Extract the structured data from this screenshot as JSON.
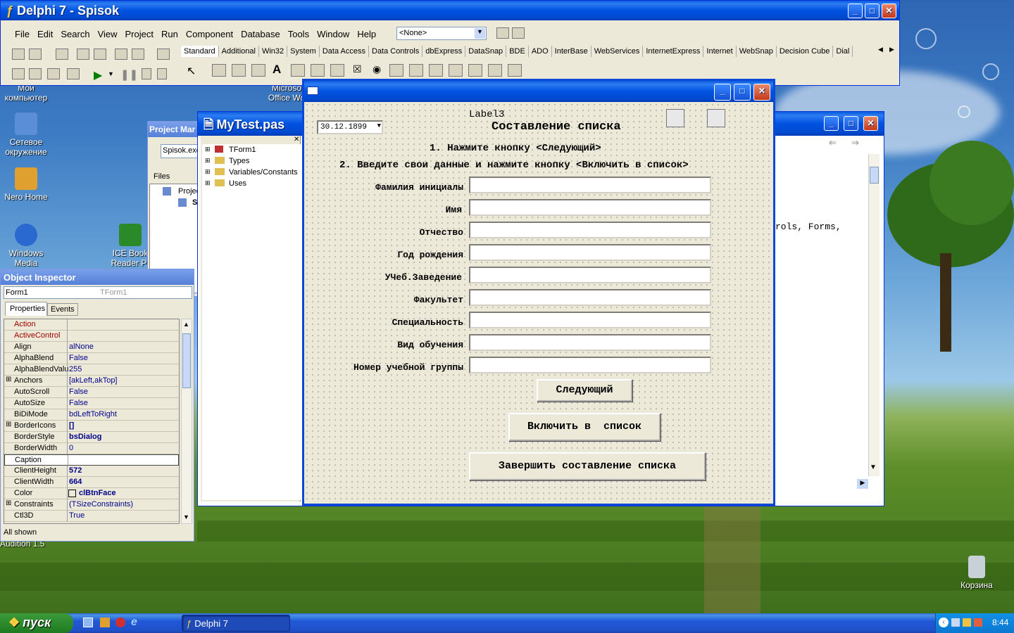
{
  "desktop": {
    "icons": [
      {
        "label": "Мой компьютер"
      },
      {
        "label": "Сетевое окружение"
      },
      {
        "label": "Nero Home"
      },
      {
        "label": "Windows Media"
      },
      {
        "label": "ICE Book Reader Pr"
      },
      {
        "label": "Microso Office Wo"
      },
      {
        "label": "Audition 1.5"
      },
      {
        "label": "Корзина"
      }
    ]
  },
  "delphi": {
    "title": "Delphi 7 - Spisok",
    "menu": [
      "File",
      "Edit",
      "Search",
      "View",
      "Project",
      "Run",
      "Component",
      "Database",
      "Tools",
      "Window",
      "Help"
    ],
    "config_combo": "<None>",
    "palette_tabs": [
      "Standard",
      "Additional",
      "Win32",
      "System",
      "Data Access",
      "Data Controls",
      "dbExpress",
      "DataSnap",
      "BDE",
      "ADO",
      "InterBase",
      "WebServices",
      "InternetExpress",
      "Internet",
      "WebSnap",
      "Decision Cube",
      "Dial"
    ]
  },
  "project_manager": {
    "title": "Project Mar",
    "combo": "Spisok.exe",
    "files_label": "Files",
    "root": "Projec",
    "child": "S"
  },
  "code_explorer": {
    "title": "MyTest.pas",
    "items": [
      "TForm1",
      "Types",
      "Variables/Constants",
      "Uses"
    ]
  },
  "editor": {
    "visible_text": "rols, Forms,"
  },
  "inspector": {
    "title": "Object Inspector",
    "object": "Form1",
    "object_type": "TForm1",
    "tabs": [
      "Properties",
      "Events"
    ],
    "props": [
      {
        "name": "Action",
        "value": "",
        "red": true
      },
      {
        "name": "ActiveControl",
        "value": "",
        "red": true
      },
      {
        "name": "Align",
        "value": "alNone"
      },
      {
        "name": "AlphaBlend",
        "value": "False"
      },
      {
        "name": "AlphaBlendValu",
        "value": "255"
      },
      {
        "name": "Anchors",
        "value": "[akLeft,akTop]",
        "plus": true
      },
      {
        "name": "AutoScroll",
        "value": "False"
      },
      {
        "name": "AutoSize",
        "value": "False"
      },
      {
        "name": "BiDiMode",
        "value": "bdLeftToRight"
      },
      {
        "name": "BorderIcons",
        "value": "[]",
        "plus": true,
        "bold": true
      },
      {
        "name": "BorderStyle",
        "value": "bsDialog",
        "bold": true
      },
      {
        "name": "BorderWidth",
        "value": "0"
      },
      {
        "name": "Caption",
        "value": "",
        "selected": true
      },
      {
        "name": "ClientHeight",
        "value": "572",
        "bold": true
      },
      {
        "name": "ClientWidth",
        "value": "664",
        "bold": true
      },
      {
        "name": "Color",
        "value": "clBtnFace",
        "bold": true
      },
      {
        "name": "Constraints",
        "value": "(TSizeConstraints)",
        "plus": true
      },
      {
        "name": "Ctl3D",
        "value": "True"
      }
    ],
    "status": "All shown"
  },
  "form": {
    "date": "30.12.1899",
    "label3": "Label3",
    "heading": "Составление списка",
    "step1": "1. Нажмите кнопку <Следующий>",
    "step2": "2. Введите свои данные и нажмите кнопку <Включить в список>",
    "fields": [
      "Фамилия инициалы",
      "Имя",
      "Отчество",
      "Год рождения",
      "УЧеб.Заведение",
      "Факультет",
      "Специальность",
      "Вид обучения",
      "Номер учебной группы"
    ],
    "btn_next": "Следующий",
    "btn_include": "Включить в  список",
    "btn_finish": "Завершить составление списка"
  },
  "taskbar": {
    "start": "пуск",
    "task": "Delphi 7",
    "clock": "8:44"
  },
  "colors": {
    "xp_blue": "#0052e0",
    "form_bg": "#ece9d8",
    "taskbar": "#245edb"
  }
}
